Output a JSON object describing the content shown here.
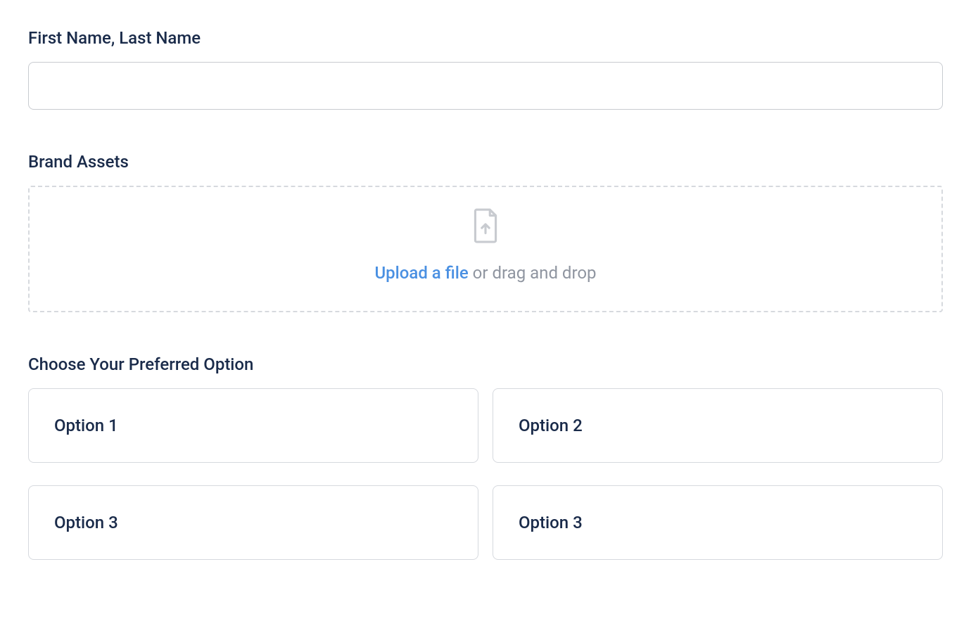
{
  "name_field": {
    "label": "First Name, Last Name",
    "value": ""
  },
  "brand_assets": {
    "label": "Brand Assets",
    "upload_link_text": "Upload a file",
    "upload_suffix_text": " or drag and drop"
  },
  "preferred_option": {
    "label": "Choose Your Preferred Option",
    "options": [
      {
        "label": "Option 1"
      },
      {
        "label": "Option 2"
      },
      {
        "label": "Option 3"
      },
      {
        "label": "Option 3"
      }
    ]
  }
}
